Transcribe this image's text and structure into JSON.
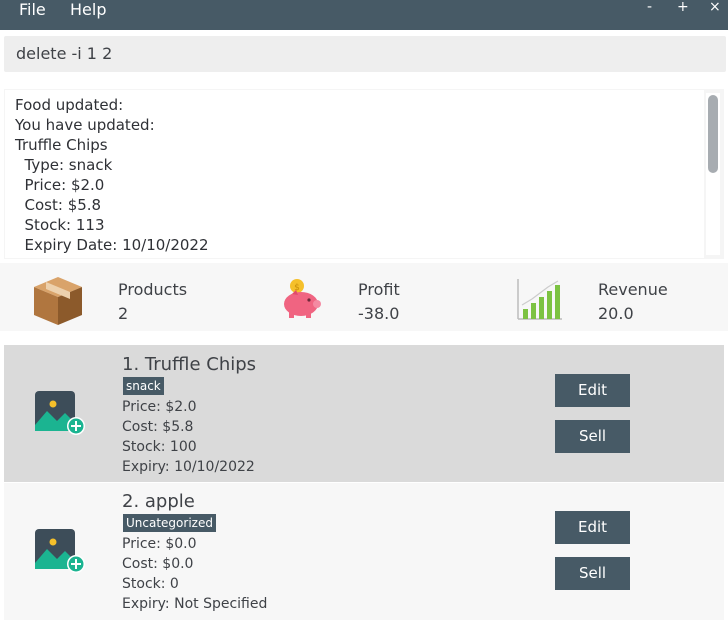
{
  "menu": {
    "file": "File",
    "help": "Help"
  },
  "window_controls": {
    "minimize": "-",
    "maximize": "+",
    "close": "×"
  },
  "command": {
    "value": "delete -i 1 2"
  },
  "result": {
    "lines": [
      "Food updated:",
      "You have updated:",
      "Truffle Chips",
      "  Type: snack",
      "  Price: $2.0",
      "  Cost: $5.8",
      "  Stock: 113",
      "  Expiry Date: 10/10/2022"
    ]
  },
  "stats": {
    "products": {
      "label": "Products",
      "value": "2"
    },
    "profit": {
      "label": "Profit",
      "value": "-38.0"
    },
    "revenue": {
      "label": "Revenue",
      "value": "20.0"
    }
  },
  "items": [
    {
      "title": "1.  Truffle Chips",
      "tag": "snack",
      "price": "Price: $2.0",
      "cost": "Cost: $5.8",
      "stock": "Stock: 100",
      "expiry": "Expiry: 10/10/2022",
      "edit_label": "Edit",
      "sell_label": "Sell"
    },
    {
      "title": "2.  apple",
      "tag": "Uncategorized",
      "price": "Price: $0.0",
      "cost": "Cost: $0.0",
      "stock": "Stock: 0",
      "expiry": "Expiry: Not Specified",
      "edit_label": "Edit",
      "sell_label": "Sell"
    }
  ],
  "colors": {
    "header": "#475a66",
    "card_selected": "#dadada",
    "card_default": "#f7f7f7",
    "accent_green": "#1bb491",
    "profit_pink": "#f06481"
  },
  "icons": {
    "products": "package-box-icon",
    "profit": "piggy-bank-icon",
    "revenue": "bar-chart-growth-icon",
    "item_image": "add-image-icon"
  }
}
